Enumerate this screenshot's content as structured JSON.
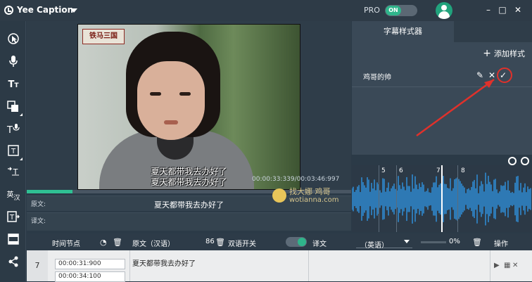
{
  "app": {
    "title": "Yee Caption",
    "pro_label": "PRO",
    "pro_toggle": "ON"
  },
  "window": {
    "minimize": "–",
    "maximize": "□",
    "close": "✕"
  },
  "left_tools": [
    "select-tool",
    "microphone-tool",
    "text-tool",
    "shape-tool",
    "voice-text-tool",
    "text-box-tool",
    "subtitle-insert-tool",
    "translate-tool",
    "text-export-tool",
    "layout-tool",
    "share-tool"
  ],
  "video": {
    "badge": "铁马三国",
    "subtitle_line1": "夏天都带我去办好了",
    "subtitle_line2": "夏天都带我去办好了",
    "timecode": "00:00:33:339/00:03:46:997",
    "progress": 0.14
  },
  "watermark": {
    "line1": "找大娜 鸡哥",
    "line2": "wotianna.com"
  },
  "original_row": {
    "label": "原文:",
    "value": "夏天都带我去办好了"
  },
  "translation_row": {
    "label": "译文:",
    "value": ""
  },
  "right_panel": {
    "tab": "字幕样式器",
    "add_style": "添加样式",
    "style_name": "鸡哥的帅"
  },
  "waveform": {
    "segments": [
      "5",
      "6",
      "7",
      "8"
    ]
  },
  "table_header": {
    "time_node": "时间节点",
    "original_lang": "原文（汉语）",
    "char_count": "86",
    "bilingual_switch": "双语开关",
    "translation": "译文",
    "language": "（英语）",
    "percent": "0%",
    "operation": "操作"
  },
  "row": {
    "number": "7",
    "start": "00:00:31:900",
    "end": "00:00:34:100",
    "text": "夏天都带我去办好了"
  }
}
